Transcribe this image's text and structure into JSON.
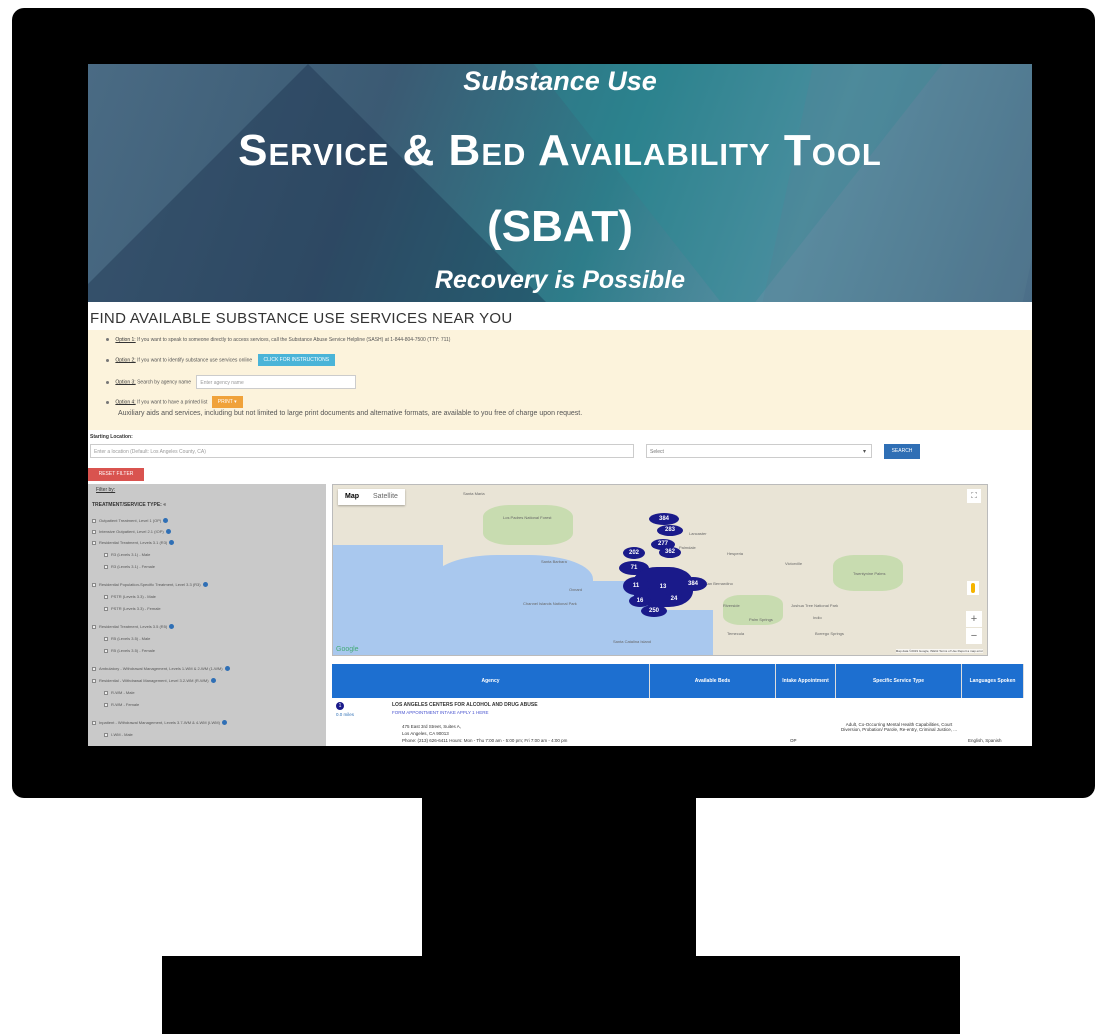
{
  "banner": {
    "subtitle": "Substance Use",
    "title": "Service & Bed Availability Tool",
    "acronym": "(SBAT)",
    "tagline": "Recovery is Possible"
  },
  "find_heading": "FIND AVAILABLE SUBSTANCE USE SERVICES NEAR YOU",
  "options": {
    "o1_label": "Option 1:",
    "o1_text": "If you want to speak to someone directly to access services, call the Substance Abuse Service Helpline (SASH) at 1-844-804-7500 (TTY: 711)",
    "o2_label": "Option 2:",
    "o2_text": "If you want to identify substance use services online",
    "o2_button": "CLICK FOR INSTRUCTIONS",
    "o3_label": "Option 3:",
    "o3_text": "Search by agency name",
    "o3_placeholder": "Enter agency name",
    "o4_label": "Option 4:",
    "o4_text": "If you want to have a printed list",
    "o4_button": "PRINT ▾",
    "aux_note": "Auxiliary aids and services, including but not limited to large print documents and alternative formats, are available to you free of charge upon request."
  },
  "search": {
    "starting_label": "Starting Location:",
    "location_placeholder": "Enter a location (Default: Los Angeles County, CA)",
    "select_value": "Select",
    "search_button": "SEARCH",
    "reset_button": "RESET FILTER"
  },
  "filter": {
    "filter_by": "Filter by:",
    "type_heading": "TREATMENT/SERVICE TYPE: «",
    "items": [
      "Outpatient Treatment, Level 1 (OP)",
      "Intensive Outpatient, Level 2.1 (IOP)",
      "Residential Treatment, Levels 3.1 (R3)",
      "R3 (Levels 3.1) - Male",
      "R3 (Levels 3.1) - Female",
      "Residential Population-Specific Treatment, Level 3.3 (R3)",
      "PSTR (Levels 3.3) - Male",
      "PSTR (Levels 3.3) - Female",
      "Residential Treatment, Levels 3.5 (R5)",
      "R5 (Levels 3.5) - Male",
      "R5 (Levels 3.5) - Female",
      "Ambulatory - Withdrawal Management, Levels 1-WM & 2-WM (1-WM)",
      "Residential - Withdrawal Management, Level 3.2-WM (R-WM)",
      "R-WM - Male",
      "R-WM - Female",
      "Inpatient - Withdrawal Management, Levels 3.7-WM & 4-WM (I-WM)",
      "I-WM - Male"
    ]
  },
  "map": {
    "tab_map": "Map",
    "tab_satellite": "Satellite",
    "google": "Google",
    "footer": "Map data ©2019 Google, INEGI   Terms of Use   Report a map error",
    "cities": [
      "Santa Maria",
      "Los Padres National Forest",
      "Lancaster",
      "Palmdale",
      "Santa Barbara",
      "Victorville",
      "Hesperia",
      "Oxnard",
      "San Bernardino",
      "Riverside",
      "Temecula",
      "Channel Islands National Park",
      "Joshua Tree National Park",
      "Borrego Springs",
      "Twentynine Palms",
      "Palm Springs",
      "Indio",
      "Santa Catalina Island"
    ],
    "clusters": [
      "384",
      "283",
      "277",
      "362",
      "202",
      "71",
      "13",
      "11",
      "384",
      "250",
      "16",
      "24"
    ]
  },
  "table": {
    "headers": [
      "Agency",
      "Available Beds",
      "Intake Appointment",
      "Specific Service Type",
      "Languages Spoken"
    ],
    "row": {
      "pin": "1",
      "distance": "0.0 miles",
      "agency_name": "LOS ANGELES CENTERS FOR ALCOHOL AND DRUG ABUSE",
      "agency_link": "FORM APPOINTMENT INTAKE APPLY 1 HERE",
      "address1": "475 East 3rd Street, Suites A,",
      "address2": "Los Angeles, CA 90013",
      "hours": "Phone: (213) 626-6411   Hours: Mon - Thu 7:00 am - 5:00 pm; Fri 7:00 am - 4:00 pm",
      "intake": "OP",
      "service_type": "Adult, Co-Occurring Mental Health Capabilities, Court Diversion, Probation/ Parole, Re-entry, Criminal Justice, ...",
      "languages": "English, Spanish"
    }
  },
  "colors": {
    "header_blue": "#1d6fd0",
    "search_blue": "#2f6fb5",
    "reset_red": "#d9534f",
    "print_orange": "#f0a23a",
    "instr_cyan": "#4ab4d8",
    "cluster_navy": "#1a1a8a"
  }
}
